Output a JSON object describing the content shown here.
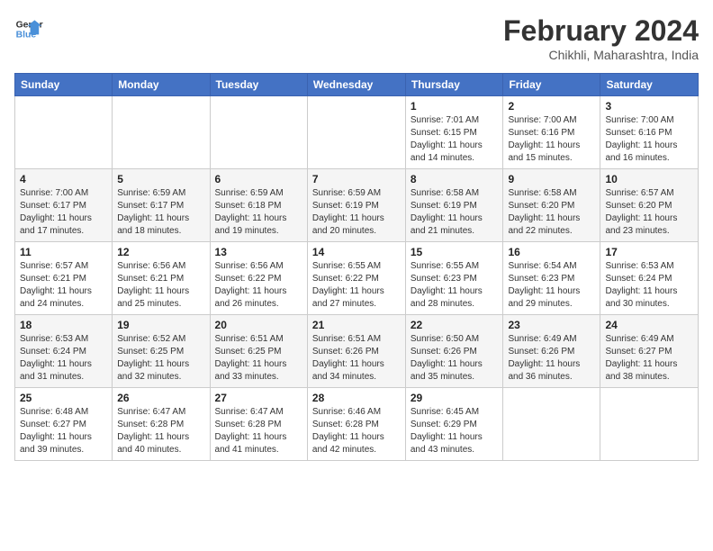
{
  "header": {
    "logo_line1": "General",
    "logo_line2": "Blue",
    "title": "February 2024",
    "subtitle": "Chikhli, Maharashtra, India"
  },
  "days_of_week": [
    "Sunday",
    "Monday",
    "Tuesday",
    "Wednesday",
    "Thursday",
    "Friday",
    "Saturday"
  ],
  "weeks": [
    [
      {
        "day": "",
        "info": ""
      },
      {
        "day": "",
        "info": ""
      },
      {
        "day": "",
        "info": ""
      },
      {
        "day": "",
        "info": ""
      },
      {
        "day": "1",
        "info": "Sunrise: 7:01 AM\nSunset: 6:15 PM\nDaylight: 11 hours\nand 14 minutes."
      },
      {
        "day": "2",
        "info": "Sunrise: 7:00 AM\nSunset: 6:16 PM\nDaylight: 11 hours\nand 15 minutes."
      },
      {
        "day": "3",
        "info": "Sunrise: 7:00 AM\nSunset: 6:16 PM\nDaylight: 11 hours\nand 16 minutes."
      }
    ],
    [
      {
        "day": "4",
        "info": "Sunrise: 7:00 AM\nSunset: 6:17 PM\nDaylight: 11 hours\nand 17 minutes."
      },
      {
        "day": "5",
        "info": "Sunrise: 6:59 AM\nSunset: 6:17 PM\nDaylight: 11 hours\nand 18 minutes."
      },
      {
        "day": "6",
        "info": "Sunrise: 6:59 AM\nSunset: 6:18 PM\nDaylight: 11 hours\nand 19 minutes."
      },
      {
        "day": "7",
        "info": "Sunrise: 6:59 AM\nSunset: 6:19 PM\nDaylight: 11 hours\nand 20 minutes."
      },
      {
        "day": "8",
        "info": "Sunrise: 6:58 AM\nSunset: 6:19 PM\nDaylight: 11 hours\nand 21 minutes."
      },
      {
        "day": "9",
        "info": "Sunrise: 6:58 AM\nSunset: 6:20 PM\nDaylight: 11 hours\nand 22 minutes."
      },
      {
        "day": "10",
        "info": "Sunrise: 6:57 AM\nSunset: 6:20 PM\nDaylight: 11 hours\nand 23 minutes."
      }
    ],
    [
      {
        "day": "11",
        "info": "Sunrise: 6:57 AM\nSunset: 6:21 PM\nDaylight: 11 hours\nand 24 minutes."
      },
      {
        "day": "12",
        "info": "Sunrise: 6:56 AM\nSunset: 6:21 PM\nDaylight: 11 hours\nand 25 minutes."
      },
      {
        "day": "13",
        "info": "Sunrise: 6:56 AM\nSunset: 6:22 PM\nDaylight: 11 hours\nand 26 minutes."
      },
      {
        "day": "14",
        "info": "Sunrise: 6:55 AM\nSunset: 6:22 PM\nDaylight: 11 hours\nand 27 minutes."
      },
      {
        "day": "15",
        "info": "Sunrise: 6:55 AM\nSunset: 6:23 PM\nDaylight: 11 hours\nand 28 minutes."
      },
      {
        "day": "16",
        "info": "Sunrise: 6:54 AM\nSunset: 6:23 PM\nDaylight: 11 hours\nand 29 minutes."
      },
      {
        "day": "17",
        "info": "Sunrise: 6:53 AM\nSunset: 6:24 PM\nDaylight: 11 hours\nand 30 minutes."
      }
    ],
    [
      {
        "day": "18",
        "info": "Sunrise: 6:53 AM\nSunset: 6:24 PM\nDaylight: 11 hours\nand 31 minutes."
      },
      {
        "day": "19",
        "info": "Sunrise: 6:52 AM\nSunset: 6:25 PM\nDaylight: 11 hours\nand 32 minutes."
      },
      {
        "day": "20",
        "info": "Sunrise: 6:51 AM\nSunset: 6:25 PM\nDaylight: 11 hours\nand 33 minutes."
      },
      {
        "day": "21",
        "info": "Sunrise: 6:51 AM\nSunset: 6:26 PM\nDaylight: 11 hours\nand 34 minutes."
      },
      {
        "day": "22",
        "info": "Sunrise: 6:50 AM\nSunset: 6:26 PM\nDaylight: 11 hours\nand 35 minutes."
      },
      {
        "day": "23",
        "info": "Sunrise: 6:49 AM\nSunset: 6:26 PM\nDaylight: 11 hours\nand 36 minutes."
      },
      {
        "day": "24",
        "info": "Sunrise: 6:49 AM\nSunset: 6:27 PM\nDaylight: 11 hours\nand 38 minutes."
      }
    ],
    [
      {
        "day": "25",
        "info": "Sunrise: 6:48 AM\nSunset: 6:27 PM\nDaylight: 11 hours\nand 39 minutes."
      },
      {
        "day": "26",
        "info": "Sunrise: 6:47 AM\nSunset: 6:28 PM\nDaylight: 11 hours\nand 40 minutes."
      },
      {
        "day": "27",
        "info": "Sunrise: 6:47 AM\nSunset: 6:28 PM\nDaylight: 11 hours\nand 41 minutes."
      },
      {
        "day": "28",
        "info": "Sunrise: 6:46 AM\nSunset: 6:28 PM\nDaylight: 11 hours\nand 42 minutes."
      },
      {
        "day": "29",
        "info": "Sunrise: 6:45 AM\nSunset: 6:29 PM\nDaylight: 11 hours\nand 43 minutes."
      },
      {
        "day": "",
        "info": ""
      },
      {
        "day": "",
        "info": ""
      }
    ]
  ]
}
